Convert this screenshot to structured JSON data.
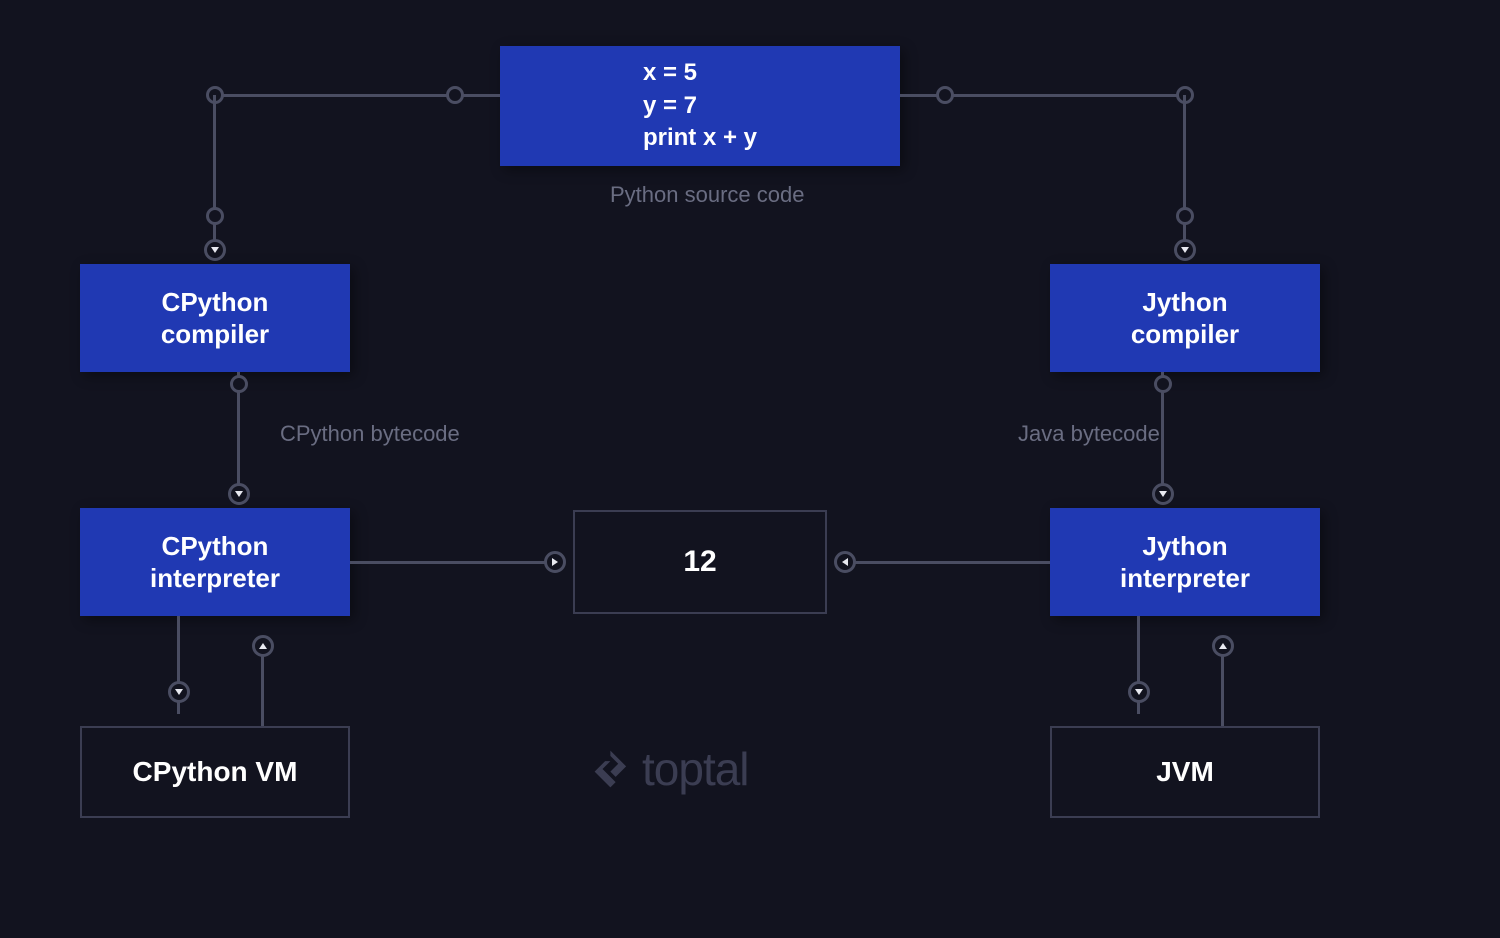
{
  "source_code": {
    "line1": "x = 5",
    "line2": "y = 7",
    "line3": "print x + y",
    "caption": "Python source code"
  },
  "left": {
    "compiler": "CPython\ncompiler",
    "bytecode_label": "CPython bytecode",
    "interpreter": "CPython\ninterpreter",
    "vm": "CPython VM"
  },
  "right": {
    "compiler": "Jython\ncompiler",
    "bytecode_label": "Java bytecode",
    "interpreter": "Jython\ninterpreter",
    "vm": "JVM"
  },
  "output": "12",
  "brand": "toptal",
  "colors": {
    "bg": "#12131f",
    "box_blue": "#2039b3",
    "outline": "#3b3d52",
    "muted_text": "#6a6d82",
    "connector": "#4a4d62"
  }
}
